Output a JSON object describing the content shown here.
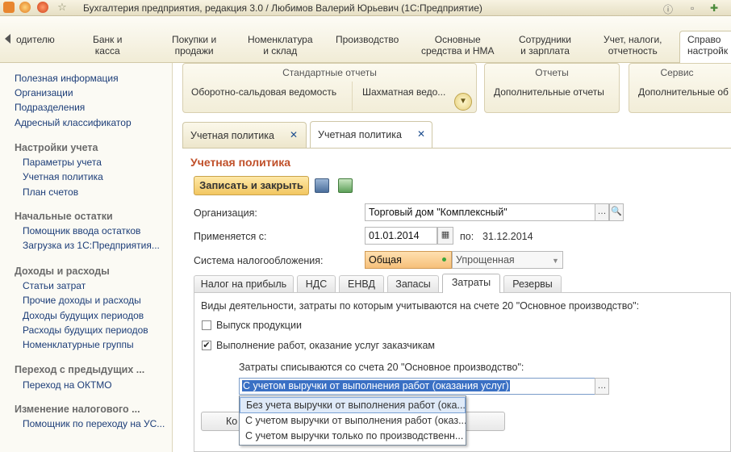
{
  "window": {
    "title": "Бухгалтерия предприятия, редакция 3.0 / Любимов Валерий Юрьевич  (1С:Предприятие)"
  },
  "sections": [
    {
      "label": "одителю"
    },
    {
      "label": "Банк и\nкасса"
    },
    {
      "label": "Покупки и\nпродажи"
    },
    {
      "label": "Номенклатура\nи склад"
    },
    {
      "label": "Производство"
    },
    {
      "label": "Основные\nсредства и НМА"
    },
    {
      "label": "Сотрудники\nи зарплата"
    },
    {
      "label": "Учет, налоги,\nотчетность"
    },
    {
      "label": "Справо\nнастройк"
    }
  ],
  "sidebar": {
    "top_links": [
      "Полезная информация",
      "Организации",
      "Подразделения",
      "Адресный классификатор"
    ],
    "groups": [
      {
        "title": "Настройки учета",
        "items": [
          "Параметры учета",
          "Учетная политика",
          "План счетов"
        ]
      },
      {
        "title": "Начальные остатки",
        "items": [
          "Помощник ввода остатков",
          "Загрузка из 1С:Предприятия..."
        ]
      },
      {
        "title": "Доходы и расходы",
        "items": [
          "Статьи затрат",
          "Прочие доходы и расходы",
          "Доходы будущих периодов",
          "Расходы будущих периодов",
          "Номенклатурные группы"
        ]
      },
      {
        "title": "Переход с предыдущих ...",
        "items": [
          "Переход на ОКТМО"
        ]
      },
      {
        "title": "Изменение налогового ...",
        "items": [
          "Помощник по переходу на УС..."
        ]
      }
    ]
  },
  "command_panel": {
    "standard_reports": {
      "title": "Стандартные отчеты",
      "items": [
        "Оборотно-сальдовая ведомость",
        "Шахматная ведо..."
      ]
    },
    "reports": {
      "title": "Отчеты",
      "items": [
        "Дополнительные отчеты"
      ]
    },
    "service": {
      "title": "Сервис",
      "items": [
        "Дополнительные об"
      ]
    }
  },
  "doc_tabs": [
    {
      "label": "Учетная политика",
      "close": "✕"
    },
    {
      "label": "Учетная политика",
      "close": "✕"
    }
  ],
  "form": {
    "title": "Учетная политика",
    "save_close": "Записать и закрыть",
    "organization_label": "Организация:",
    "organization_value": "Торговый дом \"Комплексный\"",
    "applies_label": "Применяется с:",
    "applies_value": "01.01.2014",
    "until_label": "по:",
    "until_value": "31.12.2014",
    "tax_system_label": "Система налогообложения:",
    "tax_options": [
      "Общая",
      "Упрощенная"
    ],
    "tabs": [
      "Налог на прибыль",
      "НДС",
      "ЕНВД",
      "Запасы",
      "Затраты",
      "Резервы"
    ],
    "costs": {
      "intro": "Виды деятельности, затраты по которым учитываются на счете 20 \"Основное производство\":",
      "check_products": {
        "label": "Выпуск продукции",
        "checked": false
      },
      "check_services": {
        "label": "Выполнение работ, оказание услуг заказчикам",
        "checked": true
      },
      "writeoff_label": "Затраты списываются со счета 20 \"Основное производство\":",
      "writeoff_value": "С учетом выручки от выполнения работ (оказания услуг)",
      "hidden_button_prefix": "Ко",
      "options": [
        "Без учета выручки от выполнения работ (ока...",
        "С учетом выручки от выполнения работ (оказ...",
        "С учетом выручки только по производственн..."
      ]
    }
  }
}
